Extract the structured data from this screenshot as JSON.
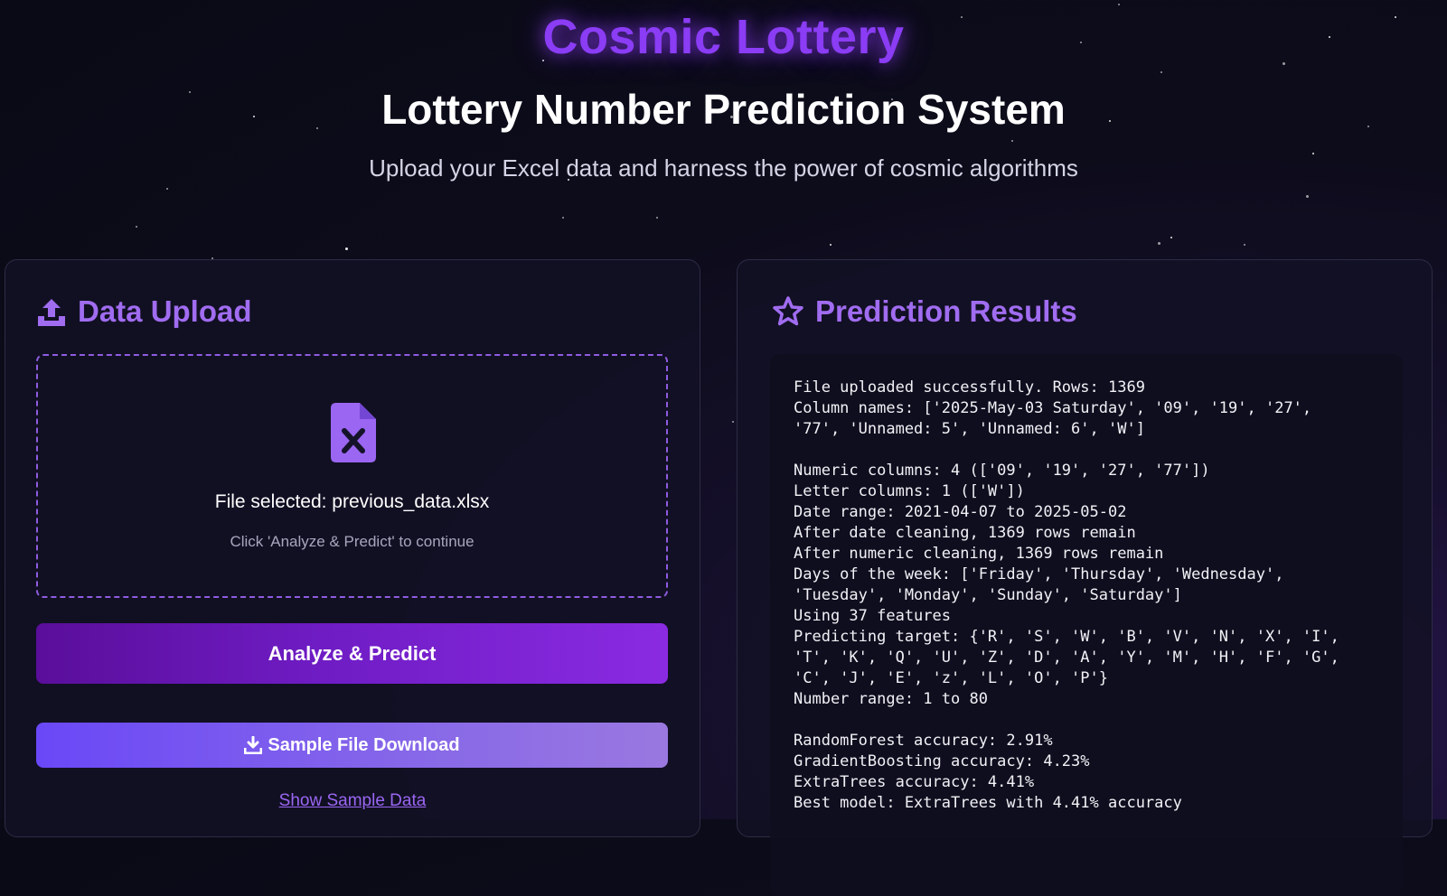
{
  "header": {
    "brand": "Cosmic Lottery",
    "title": "Lottery Number Prediction System",
    "subtitle": "Upload your Excel data and harness the power of cosmic algorithms"
  },
  "upload_panel": {
    "title": "Data Upload",
    "icon": "upload-icon",
    "dropzone": {
      "icon": "excel-file-icon",
      "file_selected": "File selected: previous_data.xlsx",
      "hint": "Click 'Analyze & Predict' to continue"
    },
    "analyze_button": "Analyze & Predict",
    "sample_download_button": "Sample File Download",
    "show_sample_link": "Show Sample Data"
  },
  "results_panel": {
    "title": "Prediction Results",
    "icon": "star-icon",
    "log_lines": [
      "File uploaded successfully. Rows: 1369",
      "Column names: ['2025-May-03 Saturday', '09', '19', '27',",
      "'77', 'Unnamed: 5', 'Unnamed: 6', 'W']",
      "",
      "Numeric columns: 4 (['09', '19', '27', '77'])",
      "Letter columns: 1 (['W'])",
      "Date range: 2021-04-07 to 2025-05-02",
      "After date cleaning, 1369 rows remain",
      "After numeric cleaning, 1369 rows remain",
      "Days of the week: ['Friday', 'Thursday', 'Wednesday',",
      "'Tuesday', 'Monday', 'Sunday', 'Saturday']",
      "Using 37 features",
      "Predicting target: {'R', 'S', 'W', 'B', 'V', 'N', 'X', 'I',",
      "'T', 'K', 'Q', 'U', 'Z', 'D', 'A', 'Y', 'M', 'H', 'F', 'G',",
      "'C', 'J', 'E', 'z', 'L', 'O', 'P'}",
      "Number range: 1 to 80",
      "",
      "RandomForest accuracy: 2.91%",
      "GradientBoosting accuracy: 4.23%",
      "ExtraTrees accuracy: 4.41%",
      "Best model: ExtraTrees with 4.41% accuracy"
    ]
  },
  "colors": {
    "accent_purple": "#8b3cf5",
    "panel_title": "#a06cf0",
    "dropzone_border": "#8e5ce0",
    "link": "#9a66f2"
  }
}
